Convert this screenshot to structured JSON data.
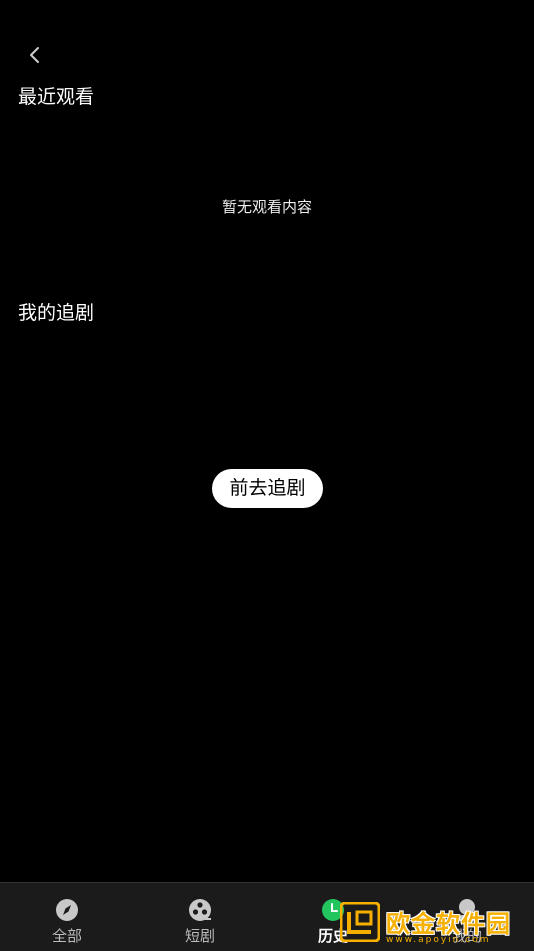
{
  "header": {
    "back_icon": "chevron-left-icon"
  },
  "recent": {
    "title": "最近观看",
    "empty_text": "暂无观看内容"
  },
  "follow": {
    "title": "我的追剧",
    "go_button": "前去追剧"
  },
  "tabbar": {
    "tabs": [
      {
        "label": "全部",
        "icon": "compass-icon",
        "active": false
      },
      {
        "label": "短剧",
        "icon": "film-reel-icon",
        "active": false
      },
      {
        "label": "历史",
        "icon": "clock-icon",
        "active": true
      },
      {
        "label": "我的",
        "icon": "user-icon",
        "active": false
      }
    ],
    "active_color": "#22c55e"
  },
  "watermark": {
    "title": "欧金软件园",
    "url": "www.apoyin.com",
    "color": "#f5b000"
  }
}
